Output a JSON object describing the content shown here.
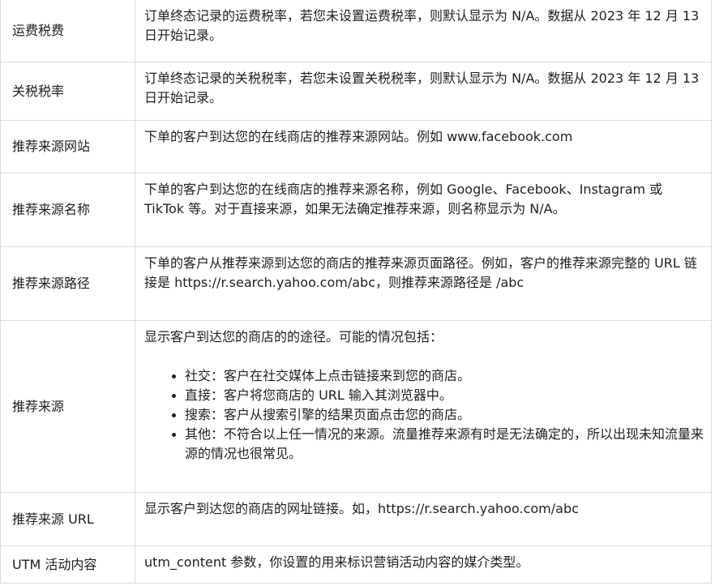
{
  "rows": [
    {
      "label": "运费税费",
      "desc": "订单终态记录的运费税率，若您未设置运费税率，则默认显示为 N/A。数据从 2023 年 12 月 13 日开始记录。"
    },
    {
      "label": "关税税率",
      "desc": "订单终态记录的关税税率，若您未设置关税税率，则默认显示为 N/A。数据从 2023 年 12 月 13 日开始记录。"
    },
    {
      "label": "推荐来源网站",
      "desc": "下单的客户到达您的在线商店的推荐来源网站。例如 www.facebook.com"
    },
    {
      "label": "推荐来源名称",
      "desc": "下单的客户到达您的在线商店的推荐来源名称，例如 Google、Facebook、Instagram 或 TikTok 等。对于直接来源，如果无法确定推荐来源，则名称显示为 N/A。"
    },
    {
      "label": "推荐来源路径",
      "desc": "下单的客户从推荐来源到达您的商店的推荐来源页面路径。例如，客户的推荐来源完整的 URL 链接是 https://r.search.yahoo.com/abc，则推荐来源路径是 /abc"
    },
    {
      "label": "推荐来源",
      "intro": "显示客户到达您的商店的的途径。可能的情况包括：",
      "bullets": [
        "社交：客户在社交媒体上点击链接来到您的商店。",
        "直接：客户将您商店的 URL 输入其浏览器中。",
        "搜索：客户从搜索引擎的结果页面点击您的商店。",
        "其他：不符合以上任一情况的来源。流量推荐来源有时是无法确定的，所以出现未知流量来源的情况也很常见。"
      ]
    },
    {
      "label": "推荐来源 URL",
      "desc": "显示客户到达您的商店的网址链接。如，https://r.search.yahoo.com/abc"
    },
    {
      "label": "UTM 活动内容",
      "desc": "utm_content 参数，你设置的用来标识营销活动内容的媒介类型。"
    }
  ]
}
